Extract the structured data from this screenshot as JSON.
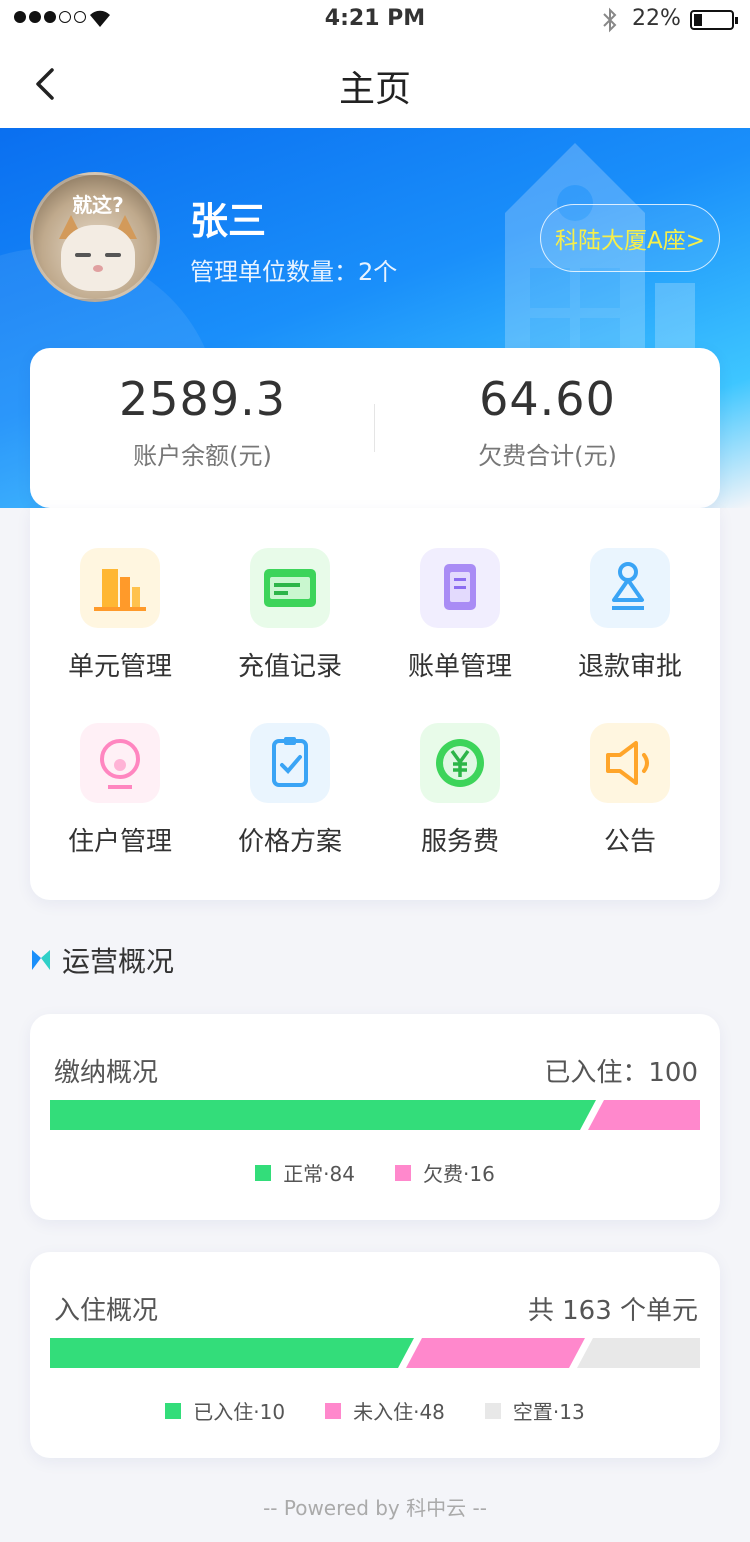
{
  "status_bar": {
    "time": "4:21 PM",
    "battery": "22%"
  },
  "nav": {
    "title": "主页"
  },
  "profile": {
    "avatar_caption": "就这?",
    "name": "张三",
    "unit_count": "管理单位数量：2个",
    "building_button": "科陆大厦A座>"
  },
  "balance": {
    "account_value": "2589.3",
    "account_label": "账户余额(元)",
    "arrears_value": "64.60",
    "arrears_label": "欠费合计(元)"
  },
  "menu": [
    {
      "label": "单元管理",
      "icon": "building-bars-icon"
    },
    {
      "label": "充值记录",
      "icon": "card-icon"
    },
    {
      "label": "账单管理",
      "icon": "clipboard-icon"
    },
    {
      "label": "退款审批",
      "icon": "person-icon"
    },
    {
      "label": "住户管理",
      "icon": "resident-icon"
    },
    {
      "label": "价格方案",
      "icon": "checklist-icon"
    },
    {
      "label": "服务费",
      "icon": "yen-icon"
    },
    {
      "label": "公告",
      "icon": "speaker-icon"
    }
  ],
  "section": {
    "title": "运营概况"
  },
  "payment": {
    "title": "缴纳概况",
    "summary": "已入住：100",
    "normal_label": "正常·84",
    "arrears_label": "欠费·16",
    "normal_value": 84,
    "arrears_value": 16
  },
  "occupancy": {
    "title": "入住概况",
    "summary": "共 163 个单元",
    "occupied_label": "已入住·10",
    "unoccupied_label": "未入住·48",
    "vacant_label": "空置·13",
    "occupied_fraction": 0.56,
    "unoccupied_fraction": 0.25,
    "vacant_fraction": 0.19
  },
  "colors": {
    "green": "#33dd7a",
    "pink": "#ff88cc",
    "grey": "#e8e8e8",
    "accent": "#1a8ffa"
  },
  "footer": {
    "text": "-- Powered by 科中云 --"
  }
}
